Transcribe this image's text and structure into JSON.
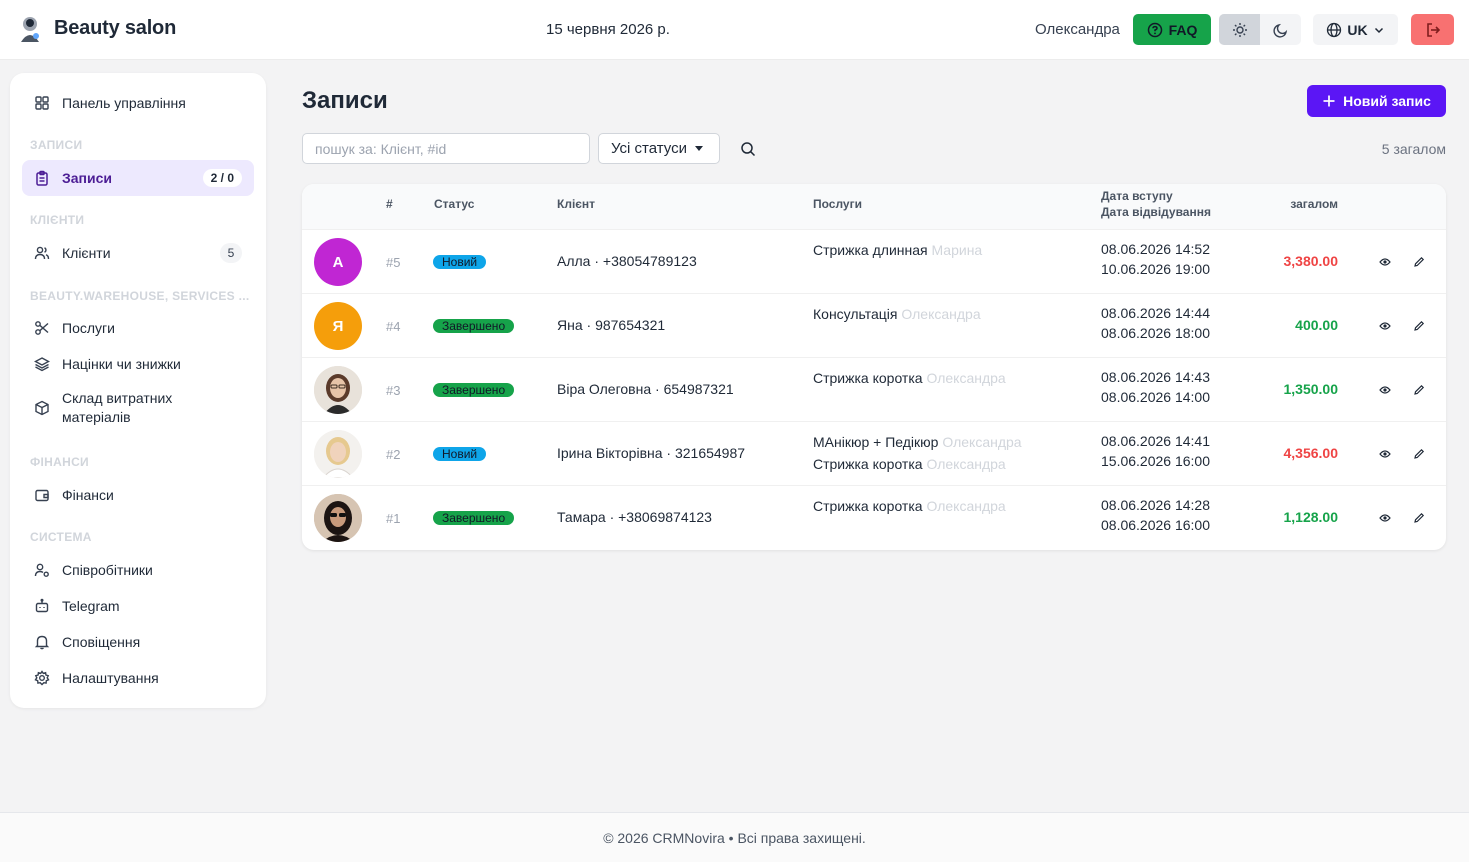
{
  "header": {
    "app_title": "Beauty salon",
    "date": "15 червня 2026 р.",
    "user_name": "Олександра",
    "faq_label": "FAQ",
    "lang_label": "UK"
  },
  "sidebar": {
    "dashboard": "Панель управління",
    "sections": {
      "records": "ЗАПИСИ",
      "clients": "КЛІЄНТИ",
      "warehouse": "BEAUTY.WAREHOUSE, SERVICES ...",
      "finance": "ФІНАНСИ",
      "system": "СИСТЕМА"
    },
    "records": {
      "label": "Записи",
      "badge": "2 / 0"
    },
    "clients": {
      "label": "Клієнти",
      "count": "5"
    },
    "services": "Послуги",
    "markups": "Націнки чи знижки",
    "warehouse_line1": "Склад витратних",
    "warehouse_line2": "матеріалів",
    "finance": "Фінанси",
    "employees": "Співробітники",
    "telegram": "Telegram",
    "notifications": "Сповіщення",
    "settings": "Налаштування"
  },
  "main": {
    "title": "Записи",
    "new_button": "Новий запис",
    "search_placeholder": "пошук за: Клієнт, #id",
    "status_filter": "Усі статуси",
    "total": "5 загалом"
  },
  "table": {
    "headers": {
      "id": "#",
      "status": "Статус",
      "client": "Клієнт",
      "services": "Послуги",
      "date_entry": "Дата вступу",
      "date_visit": "Дата відвідування",
      "total": "загалом"
    },
    "rows": [
      {
        "avatar_letter": "А",
        "avatar_color": "#c026d3",
        "id": "#5",
        "status": "Новий",
        "client": "Алла · +38054789123",
        "service1": "Стрижка длинная",
        "master1": "Марина",
        "service2": "",
        "master2": "",
        "date_entry": "08.06.2026 14:52",
        "date_visit": "10.06.2026 19:00",
        "amount": "3,380.00"
      },
      {
        "avatar_letter": "Я",
        "avatar_color": "#f59e0b",
        "id": "#4",
        "status": "Завершено",
        "client": "Яна · 987654321",
        "service1": "Консультація",
        "master1": "Олександра",
        "service2": "",
        "master2": "",
        "date_entry": "08.06.2026 14:44",
        "date_visit": "08.06.2026 18:00",
        "amount": "400.00"
      },
      {
        "avatar_letter": "",
        "avatar_color": "",
        "id": "#3",
        "status": "Завершено",
        "client": "Віра Олеговна · 654987321",
        "service1": "Стрижка коротка",
        "master1": "Олександра",
        "service2": "",
        "master2": "",
        "date_entry": "08.06.2026 14:43",
        "date_visit": "08.06.2026 14:00",
        "amount": "1,350.00"
      },
      {
        "avatar_letter": "",
        "avatar_color": "",
        "id": "#2",
        "status": "Новий",
        "client": "Ірина Вікторівна · 321654987",
        "service1": "МАнікюр + Педікюр",
        "master1": "Олександра",
        "service2": "Стрижка коротка",
        "master2": "Олександра",
        "date_entry": "08.06.2026 14:41",
        "date_visit": "15.06.2026 16:00",
        "amount": "4,356.00"
      },
      {
        "avatar_letter": "",
        "avatar_color": "",
        "id": "#1",
        "status": "Завершено",
        "client": "Тамара · +38069874123",
        "service1": "Стрижка коротка",
        "master1": "Олександра",
        "service2": "",
        "master2": "",
        "date_entry": "08.06.2026 14:28",
        "date_visit": "08.06.2026 16:00",
        "amount": "1,128.00"
      }
    ]
  },
  "footer": {
    "text": "© 2026 CRMNovira • Всі права захищені."
  },
  "colors": {
    "accent": "#5b16f5",
    "faq_green": "#16a34a",
    "logout_red": "#f87171",
    "status_new": "#0ea5e9",
    "status_done": "#16a34a",
    "amount_red": "#ef4444",
    "amount_green": "#16a34a"
  }
}
